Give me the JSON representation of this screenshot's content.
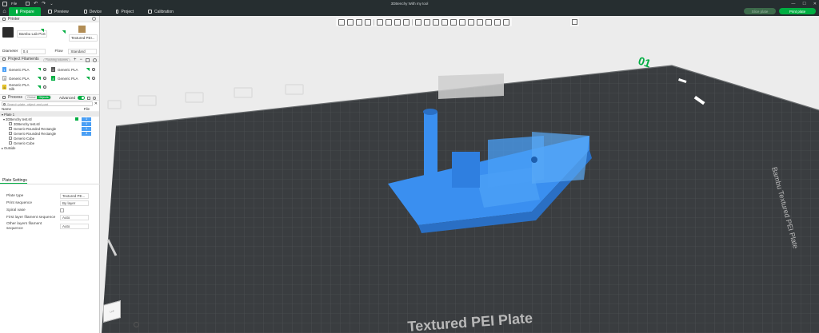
{
  "window": {
    "title": "3DBenchy With my tool",
    "menu_label": "File",
    "controls": [
      "—",
      "☐",
      "✕"
    ]
  },
  "tabs": [
    {
      "label": "Prepare",
      "active": true
    },
    {
      "label": "Preview",
      "active": false
    },
    {
      "label": "Device",
      "active": false
    },
    {
      "label": "Project",
      "active": false
    },
    {
      "label": "Calibration",
      "active": false
    }
  ],
  "actions": {
    "slice_label": "Slice plate",
    "print_label": "Print plate"
  },
  "printer": {
    "section_label": "Printer",
    "name": "Bambu Lab P1S",
    "plate": "Textured PEI...",
    "diameter_label": "Diameter",
    "diameter_value": "0.4",
    "flow_label": "Flow",
    "flow_value": "Standard"
  },
  "filaments": {
    "section_label": "Project Filaments",
    "flush_label": "Flushing volumes",
    "items": [
      {
        "num": "1",
        "name": "Generic PLA",
        "color": "#4a9ff5"
      },
      {
        "num": "2",
        "name": "Generic PLA",
        "color": "#555555"
      },
      {
        "num": "3",
        "name": "Generic PLA",
        "color": "#ffffff"
      },
      {
        "num": "4",
        "name": "Generic PLA",
        "color": "#00ae42"
      },
      {
        "num": "5",
        "name": "Generic PLA Silk",
        "color": "#f3d44a"
      }
    ]
  },
  "process": {
    "section_label": "Process",
    "global_label": "Global",
    "objects_label": "Objects",
    "advanced_label": "Advanced",
    "search_placeholder": "Search plate, object and part",
    "col_name": "Name",
    "col_file": "File"
  },
  "tree": [
    {
      "label": "Plate 1",
      "level": 0,
      "kind": "plate"
    },
    {
      "label": "3DBenchy test.stl",
      "level": 1,
      "badge": "1"
    },
    {
      "label": "3DBenchy test.stl",
      "level": 2,
      "badge": "1"
    },
    {
      "label": "Generic-Rounded Rectangle",
      "level": 2,
      "badge": "1"
    },
    {
      "label": "Generic-Rounded Rectangle",
      "level": 2,
      "badge": "4"
    },
    {
      "label": "Generic-Cube",
      "level": 2
    },
    {
      "label": "Generic-Cube",
      "level": 2
    },
    {
      "label": "Outside",
      "level": 0
    }
  ],
  "plate_settings": {
    "tab_label": "Plate Settings",
    "rows": [
      {
        "label": "Plate type",
        "value": "Textured PE..."
      },
      {
        "label": "Print sequence",
        "value": "By layer"
      },
      {
        "label": "Spiral vase",
        "value": ""
      },
      {
        "label": "First layer filament sequence",
        "value": "Auto"
      },
      {
        "label": "Other layers filament sequence",
        "value": "Auto"
      }
    ]
  },
  "viewport": {
    "bed_label": "Textured PEI Plate",
    "bed_side_label": "Bambu Textured PEI Plate",
    "plate_number": "01",
    "view_cube_label": "Left",
    "model_color": "#3a8ff0",
    "bed_color": "#3a3d40"
  }
}
